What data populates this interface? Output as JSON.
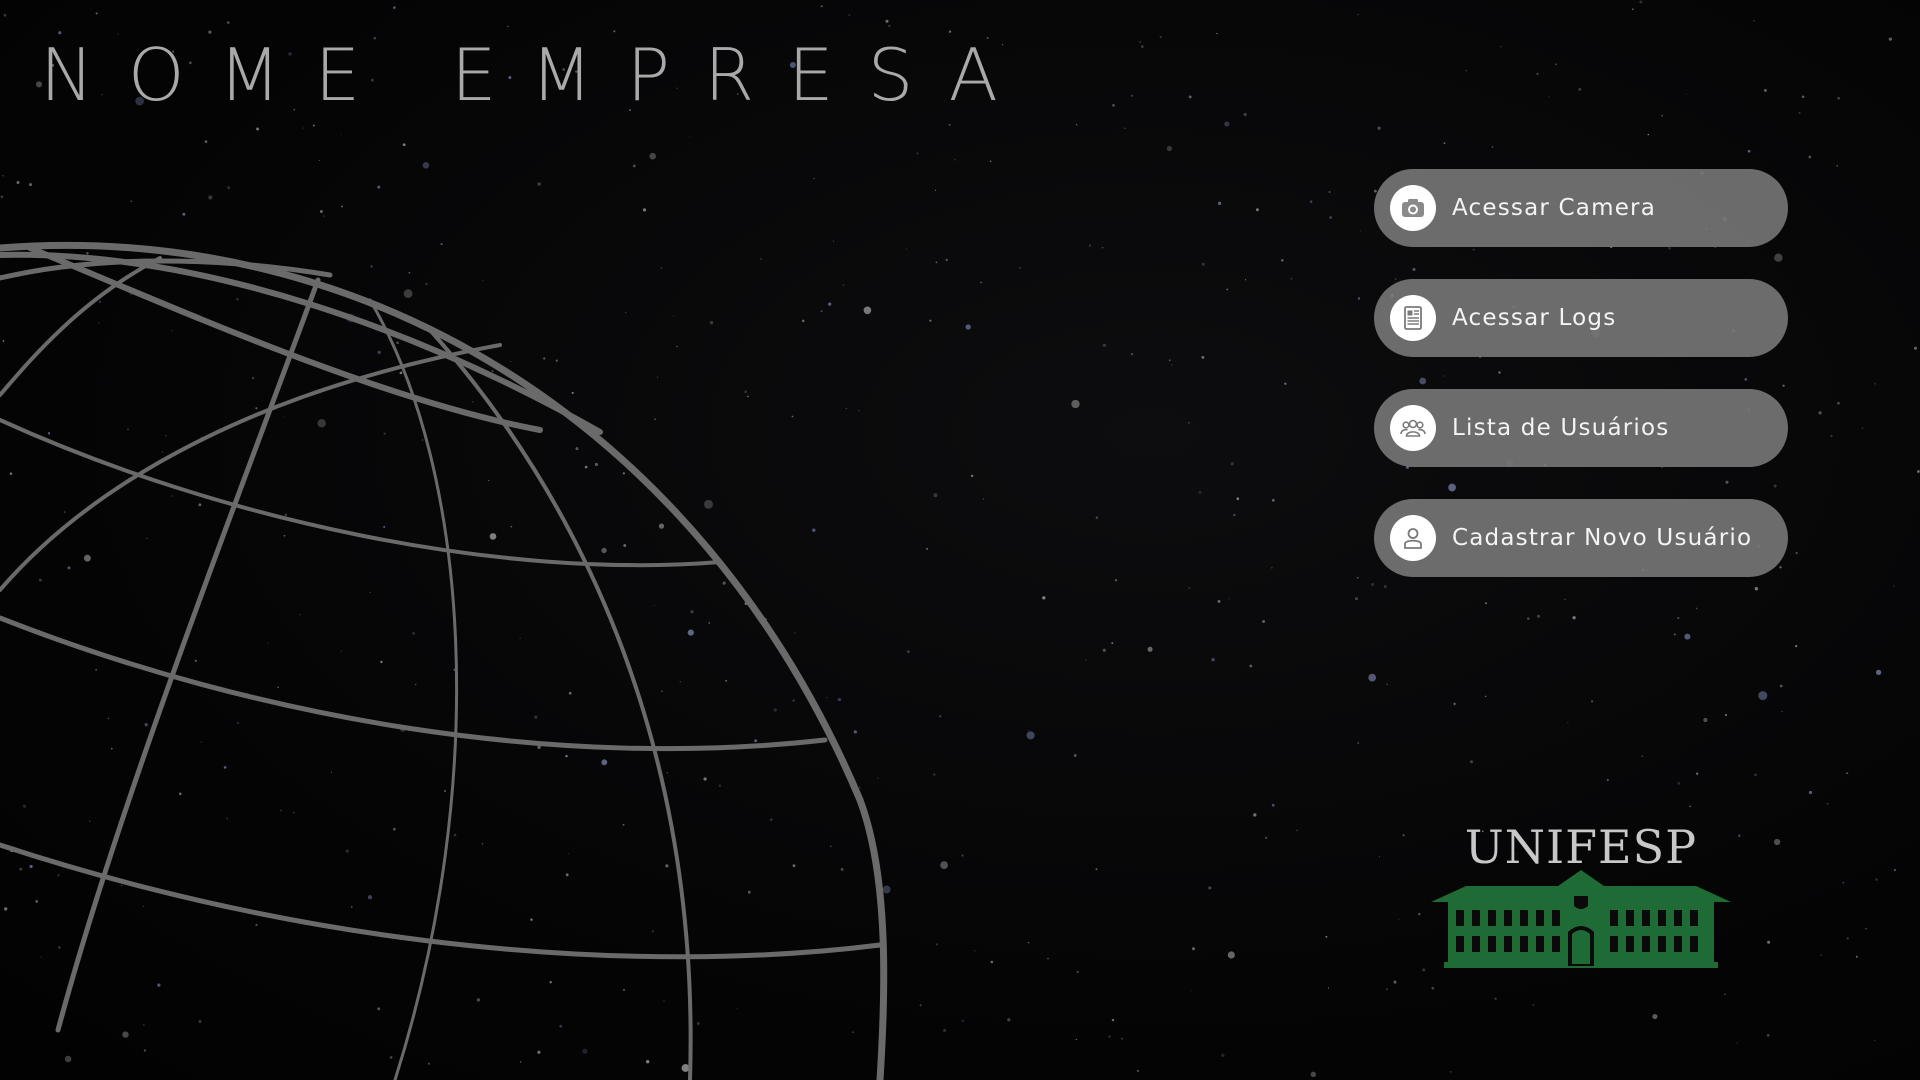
{
  "header": {
    "company_name": "NOME EMPRESA"
  },
  "menu": {
    "items": [
      {
        "label": "Acessar Camera",
        "icon": "camera-icon"
      },
      {
        "label": "Acessar Logs",
        "icon": "document-icon"
      },
      {
        "label": "Lista de Usuários",
        "icon": "users-group-icon"
      },
      {
        "label": "Cadastrar Novo Usuário",
        "icon": "user-icon"
      }
    ]
  },
  "logo": {
    "text": "UNIFESP"
  },
  "colors": {
    "background": "#050505",
    "button": "#7a7a7a",
    "title": "#a9a9a9",
    "logo_green": "#1f6b35",
    "globe_lines": "#6a6a6a"
  }
}
